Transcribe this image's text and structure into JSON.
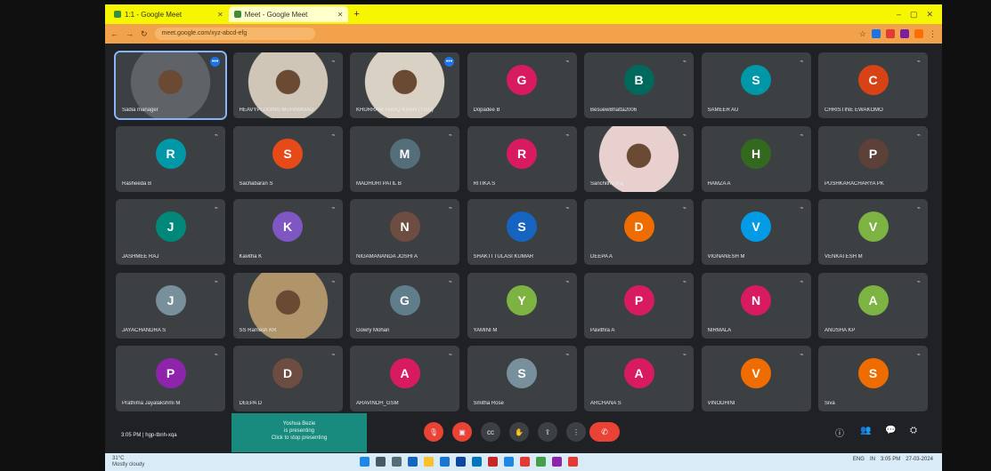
{
  "browser": {
    "tabs": [
      {
        "title": "1:1 - Google Meet"
      },
      {
        "title": "Meet - Google Meet"
      }
    ],
    "new_tab_label": "+",
    "url": "meet.google.com/xyz-abcd-efg",
    "window_controls": [
      "–",
      "▢",
      "✕"
    ]
  },
  "participants": [
    {
      "name": "Sadia manager",
      "initial": "",
      "color": "#5f6368",
      "photo": true,
      "self": true,
      "indicator": "blue"
    },
    {
      "name": "HEAVYPLUGINS MUHAMMAD",
      "initial": "",
      "color": "#cfc6b8",
      "photo": true,
      "indicator": "mute"
    },
    {
      "name": "KHURRAM TARIQ KHAN (YOU)",
      "initial": "",
      "color": "#d9d2c4",
      "photo": true,
      "indicator": "blue"
    },
    {
      "name": "Dopadee B",
      "initial": "G",
      "color": "#d81b60",
      "indicator": "mute"
    },
    {
      "name": "BesuewBhatta2006",
      "initial": "B",
      "color": "#00695c",
      "indicator": "mute"
    },
    {
      "name": "SAMEER AU",
      "initial": "S",
      "color": "#0097a7",
      "indicator": "mute"
    },
    {
      "name": "CHRISTINE EWAKOMO",
      "initial": "C",
      "color": "#d84315",
      "indicator": "mute"
    },
    {
      "name": "Rasheeda B",
      "initial": "R",
      "color": "#0097a7",
      "indicator": "mute"
    },
    {
      "name": "Sachabaran S",
      "initial": "S",
      "color": "#e64a19",
      "indicator": "mute"
    },
    {
      "name": "MADHURI PATIL B",
      "initial": "M",
      "color": "#546e7a",
      "indicator": "mute"
    },
    {
      "name": "RITIKA S",
      "initial": "R",
      "color": "#d81b60",
      "indicator": "mute"
    },
    {
      "name": "Sanchitha Raj",
      "initial": "",
      "color": "#e8d0cf",
      "photo": true,
      "indicator": "mute"
    },
    {
      "name": "HAMZA A",
      "initial": "H",
      "color": "#33691e",
      "indicator": "mute"
    },
    {
      "name": "PUSHKARACHARYA PK",
      "initial": "P",
      "color": "#5d4037",
      "indicator": "mute"
    },
    {
      "name": "JASHMEE RAJ",
      "initial": "J",
      "color": "#00897b",
      "indicator": "mute"
    },
    {
      "name": "Kavitha K",
      "initial": "K",
      "color": "#7e57c2",
      "indicator": "mute"
    },
    {
      "name": "NIGAMANANDA JOSHI A",
      "initial": "N",
      "color": "#6d4c41",
      "indicator": "mute"
    },
    {
      "name": "SHAKTI TULASI KUMAR",
      "initial": "S",
      "color": "#1565c0",
      "indicator": "mute"
    },
    {
      "name": "DEEPA A",
      "initial": "D",
      "color": "#ef6c00",
      "indicator": "mute"
    },
    {
      "name": "VIGNANESH M",
      "initial": "V",
      "color": "#039be5",
      "indicator": "mute"
    },
    {
      "name": "VENKATESH M",
      "initial": "V",
      "color": "#7cb342",
      "indicator": "mute"
    },
    {
      "name": "JAYACHANDRA S",
      "initial": "J",
      "color": "#78909c",
      "indicator": "mute"
    },
    {
      "name": "SS Ramesh KR",
      "initial": "",
      "color": "#b0956a",
      "photo": true,
      "indicator": "mute"
    },
    {
      "name": "Gowry Mohan",
      "initial": "G",
      "color": "#607d8b",
      "indicator": "mute"
    },
    {
      "name": "YAMINI M",
      "initial": "Y",
      "color": "#7cb342",
      "indicator": "mute"
    },
    {
      "name": "Pavithra A",
      "initial": "P",
      "color": "#d81b60",
      "indicator": "mute"
    },
    {
      "name": "NIRMALA",
      "initial": "N",
      "color": "#d81b60",
      "indicator": "mute"
    },
    {
      "name": "ANUSHA KP",
      "initial": "A",
      "color": "#7cb342",
      "indicator": "mute"
    },
    {
      "name": "Prathima Jayalakshmi M",
      "initial": "P",
      "color": "#8e24aa",
      "indicator": "mute"
    },
    {
      "name": "DEEPA D",
      "initial": "D",
      "color": "#6d4c41",
      "indicator": "mute"
    },
    {
      "name": "ARAVINDH_GSM",
      "initial": "A",
      "color": "#d81b60",
      "indicator": "mute"
    },
    {
      "name": "Smitha Rose",
      "initial": "S",
      "color": "#78909c",
      "indicator": "mute"
    },
    {
      "name": "ARCHANA S",
      "initial": "A",
      "color": "#d81b60",
      "indicator": "mute"
    },
    {
      "name": "VINODHINI",
      "initial": "V",
      "color": "#ef6c00",
      "indicator": "mute"
    },
    {
      "name": "Siva",
      "initial": "S",
      "color": "#ef6c00",
      "indicator": "mute"
    }
  ],
  "controls": {
    "time": "3:05 PM  |  hgp-tbnh-xqa",
    "presenting_lines": [
      "Yoshua Bezie",
      "is presenting",
      "Click to stop presenting"
    ],
    "buttons": [
      "mic",
      "cam",
      "cc",
      "hand",
      "present",
      "more"
    ],
    "end_call": "✆",
    "side": [
      "ⓘ",
      "👥",
      "💬",
      "⛭"
    ]
  },
  "taskbar": {
    "weather": [
      "31°C",
      "Mostly cloudy"
    ],
    "tray": [
      "ENG",
      "IN",
      "3:05 PM",
      "27-03-2024"
    ]
  },
  "colors": {
    "meet_bg": "#202124",
    "tile_bg": "#3c4043",
    "end_call": "#ea4335",
    "presenting": "#188a7e",
    "tab_bar": "#f6f600",
    "address_bar": "#f2a24b"
  }
}
